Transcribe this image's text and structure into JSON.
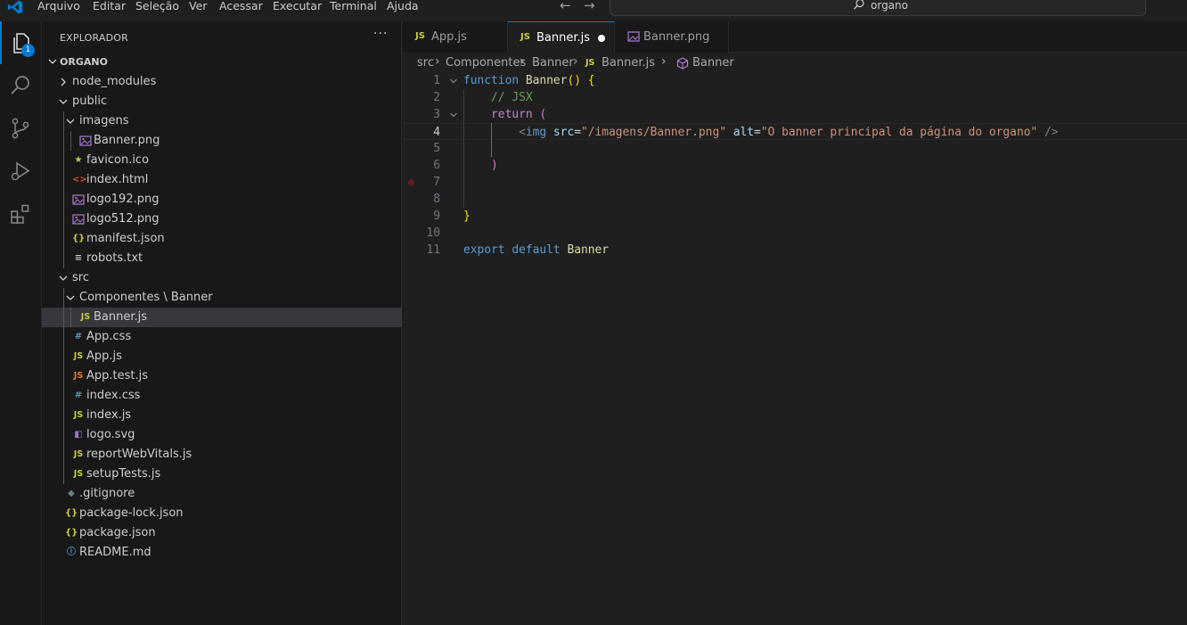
{
  "menu": {
    "items": [
      "Arquivo",
      "Editar",
      "Seleção",
      "Ver",
      "Acessar",
      "Executar",
      "Terminal",
      "Ajuda"
    ],
    "search_text": "organo"
  },
  "activity": {
    "explorer_badge": "1",
    "icons": [
      "files-icon",
      "search-icon",
      "source-control-icon",
      "run-debug-icon",
      "extensions-icon"
    ]
  },
  "sidebar": {
    "title": "EXPLORADOR",
    "more": "···",
    "project": "ORGANO",
    "tree": [
      {
        "name": "node_modules",
        "type": "folder",
        "expanded": false
      },
      {
        "name": "public",
        "type": "folder",
        "expanded": true
      },
      {
        "name": "imagens",
        "type": "folder",
        "expanded": true
      },
      {
        "name": "Banner.png",
        "type": "image"
      },
      {
        "name": "favicon.ico",
        "type": "favicon"
      },
      {
        "name": "index.html",
        "type": "html"
      },
      {
        "name": "logo192.png",
        "type": "image"
      },
      {
        "name": "logo512.png",
        "type": "image"
      },
      {
        "name": "manifest.json",
        "type": "json"
      },
      {
        "name": "robots.txt",
        "type": "text"
      },
      {
        "name": "src",
        "type": "folder",
        "expanded": true
      },
      {
        "name": "Componentes \\ Banner",
        "type": "folder",
        "expanded": true
      },
      {
        "name": "Banner.js",
        "type": "js",
        "selected": true
      },
      {
        "name": "App.css",
        "type": "css"
      },
      {
        "name": "App.js",
        "type": "js"
      },
      {
        "name": "App.test.js",
        "type": "test"
      },
      {
        "name": "index.css",
        "type": "css"
      },
      {
        "name": "index.js",
        "type": "js"
      },
      {
        "name": "logo.svg",
        "type": "svg"
      },
      {
        "name": "reportWebVitals.js",
        "type": "js"
      },
      {
        "name": "setupTests.js",
        "type": "js"
      },
      {
        "name": ".gitignore",
        "type": "git"
      },
      {
        "name": "package-lock.json",
        "type": "json"
      },
      {
        "name": "package.json",
        "type": "json"
      },
      {
        "name": "README.md",
        "type": "info"
      }
    ]
  },
  "tabs": [
    {
      "label": "App.js",
      "icon": "JS",
      "active": false
    },
    {
      "label": "Banner.js",
      "icon": "JS",
      "active": true,
      "dirty": true
    },
    {
      "label": "Banner.png",
      "icon": "image",
      "active": false
    }
  ],
  "breadcrumb": {
    "items": [
      "src",
      "Componentes",
      "Banner",
      "Banner.js",
      "Banner"
    ],
    "js_icon": "JS"
  },
  "editor": {
    "current_line": 4,
    "breakpoint_line": 7,
    "lines": [
      {
        "n": "1",
        "tokens": [
          [
            "kw",
            "function"
          ],
          [
            "pl",
            " "
          ],
          [
            "fn",
            "Banner"
          ],
          [
            "br1",
            "()"
          ],
          [
            "pl",
            " "
          ],
          [
            "br1",
            "{"
          ]
        ]
      },
      {
        "n": "2",
        "tokens": [
          [
            "pl",
            "    "
          ],
          [
            "cm",
            "// JSX"
          ]
        ]
      },
      {
        "n": "3",
        "tokens": [
          [
            "pl",
            "    "
          ],
          [
            "ctl",
            "return"
          ],
          [
            "pl",
            " "
          ],
          [
            "br2",
            "("
          ]
        ]
      },
      {
        "n": "4",
        "tokens": [
          [
            "pl",
            "        "
          ],
          [
            "tagb",
            "<"
          ],
          [
            "tag",
            "img"
          ],
          [
            "pl",
            " "
          ],
          [
            "attr",
            "src"
          ],
          [
            "pl",
            "="
          ],
          [
            "str",
            "\"/imagens/Banner.png\""
          ],
          [
            "pl",
            " "
          ],
          [
            "attr",
            "alt"
          ],
          [
            "pl",
            "="
          ],
          [
            "str",
            "\"O banner principal da página do organo\""
          ],
          [
            "pl",
            " "
          ],
          [
            "tagb",
            "/>"
          ]
        ]
      },
      {
        "n": "5",
        "tokens": []
      },
      {
        "n": "6",
        "tokens": [
          [
            "pl",
            "    "
          ],
          [
            "br2",
            ")"
          ]
        ]
      },
      {
        "n": "7",
        "tokens": []
      },
      {
        "n": "8",
        "tokens": []
      },
      {
        "n": "9",
        "tokens": [
          [
            "br1",
            "}"
          ]
        ]
      },
      {
        "n": "10",
        "tokens": []
      },
      {
        "n": "11",
        "tokens": [
          [
            "kw",
            "export"
          ],
          [
            "pl",
            " "
          ],
          [
            "kw",
            "default"
          ],
          [
            "pl",
            " "
          ],
          [
            "fn",
            "Banner"
          ]
        ]
      }
    ]
  },
  "colors": {
    "accent": "#0078d4",
    "js_icon": "#cbcb41",
    "test_icon": "#e37933",
    "css_icon": "#519aba",
    "image_icon": "#a074c4",
    "html_icon": "#e44d26",
    "breakpoint": "#6b1b1b"
  }
}
